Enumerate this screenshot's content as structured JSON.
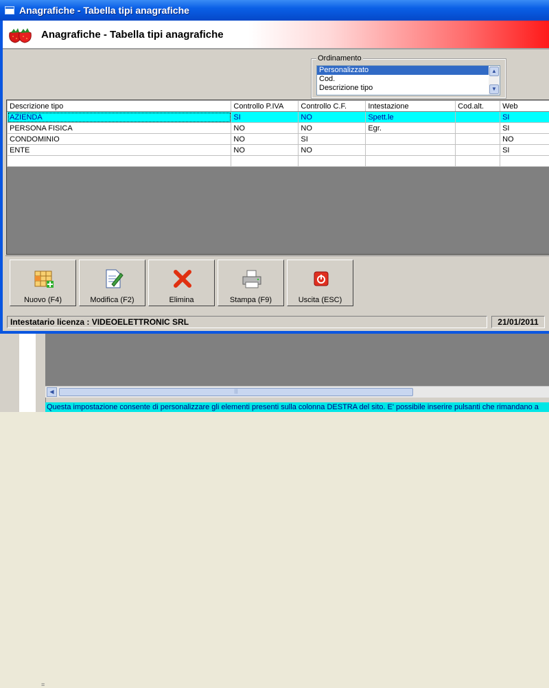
{
  "window": {
    "title": "Anagrafiche - Tabella tipi anagrafiche"
  },
  "header": {
    "title": "Anagrafiche - Tabella tipi anagrafiche"
  },
  "ordinamento": {
    "legend": "Ordinamento",
    "items": [
      "Personalizzato",
      "Cod.",
      "Descrizione tipo"
    ],
    "selected": "Personalizzato"
  },
  "grid": {
    "columns": [
      "Descrizione tipo",
      "Controllo P.IVA",
      "Controllo C.F.",
      "Intestazione",
      "Cod.alt.",
      "Web"
    ],
    "rows": [
      [
        "AZIENDA",
        "SI",
        "NO",
        "Spett.le",
        "",
        "SI"
      ],
      [
        "PERSONA FISICA",
        "NO",
        "NO",
        "Egr.",
        "",
        "SI"
      ],
      [
        "CONDOMINIO",
        "NO",
        "SI",
        "",
        "",
        "NO"
      ],
      [
        "ENTE",
        "NO",
        "NO",
        "",
        "",
        "SI"
      ],
      [
        "",
        "",
        "",
        "",
        "",
        ""
      ]
    ],
    "highlight_color": "#00ffff"
  },
  "toolbar": {
    "nuovo": "Nuovo (F4)",
    "modifica": "Modifica (F2)",
    "elimina": "Elimina",
    "stampa": "Stampa (F9)",
    "uscita": "Uscita (ESC)"
  },
  "status": {
    "license": "Intestatario licenza : VIDEOELETTRONIC SRL",
    "date": "21/01/2011"
  },
  "background": {
    "info_text": "Questa impostazione consente di personalizzare gli elementi presenti sulla colonna DESTRA del sito. E' possibile inserire pulsanti che rimandano a"
  }
}
